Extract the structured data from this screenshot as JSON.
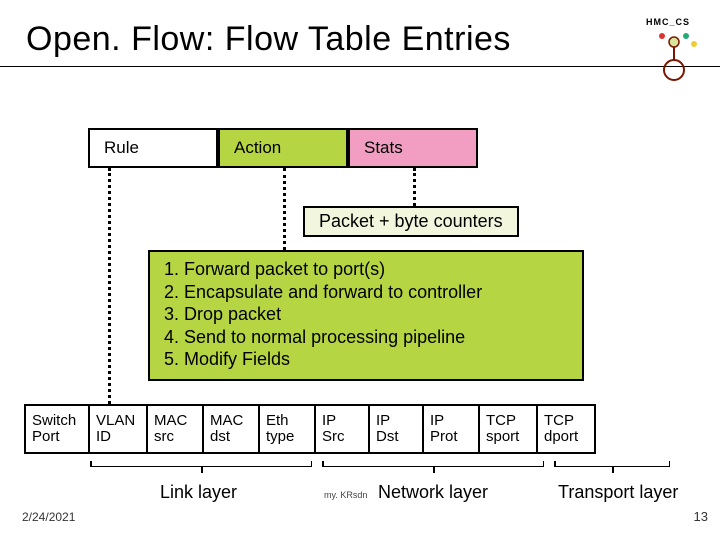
{
  "title": "Open. Flow: Flow Table Entries",
  "boxes": {
    "rule": "Rule",
    "action": "Action",
    "stats": "Stats"
  },
  "stats_callout": "Packet + byte counters",
  "actions": [
    "Forward packet to port(s)",
    "Encapsulate and forward to controller",
    "Drop packet",
    "Send to normal processing pipeline",
    "Modify Fields"
  ],
  "fields": [
    "Switch\nPort",
    "VLAN\nID",
    "MAC\nsrc",
    "MAC\ndst",
    "Eth\ntype",
    "IP\nSrc",
    "IP\nDst",
    "IP\nProt",
    "TCP\nsport",
    "TCP\ndport"
  ],
  "layers": {
    "link": "Link layer",
    "network": "Network layer",
    "transport": "Transport layer"
  },
  "network_sub": "my. KRsdn",
  "footer": {
    "date": "2/24/2021",
    "page": "13"
  },
  "logo_text": "HMC_CS"
}
